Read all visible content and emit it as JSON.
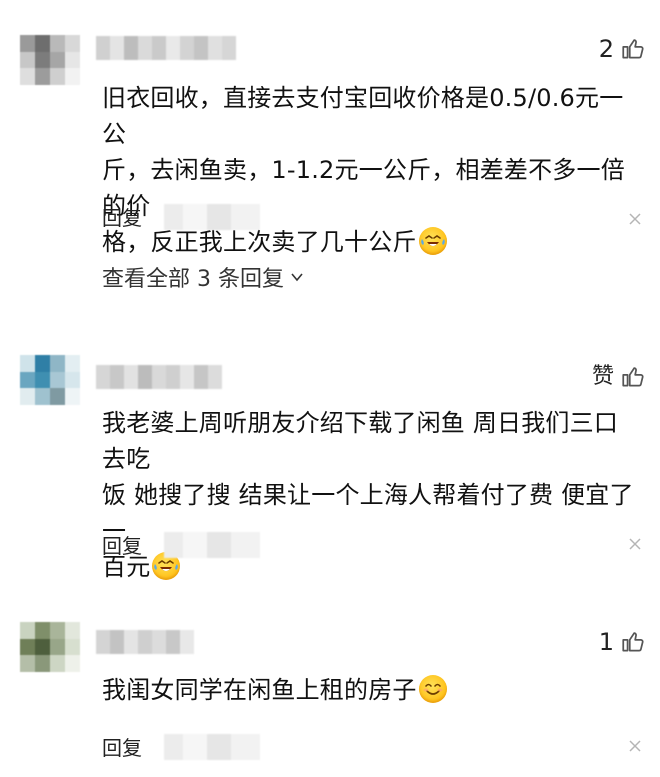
{
  "comments": [
    {
      "like_count": "2",
      "text": "旧衣回收，直接去支付宝回收价格是0.5/0.6元一公\n斤，去闲鱼卖，1-1.2元一公斤，相差差不多一倍的价\n格，反正我上次卖了几十公斤",
      "emoji": "laughing-tears",
      "reply_label": "回复",
      "view_replies": "查看全部 3 条回复"
    },
    {
      "like_count": "赞",
      "text": "我老婆上周听朋友介绍下载了闲鱼 周日我们三口去吃\n饭 她搜了搜 结果让一个上海人帮着付了费 便宜了一\n百元",
      "emoji": "laughing-tears",
      "reply_label": "回复"
    },
    {
      "like_count": "1",
      "text": "我闺女同学在闲鱼上租的房子",
      "emoji": "smiling-face",
      "reply_label": "回复"
    }
  ],
  "colors": {
    "emoji_yellow": "#ffc21a",
    "tear_blue": "#5aa9e6",
    "icon_gray": "#555555"
  }
}
